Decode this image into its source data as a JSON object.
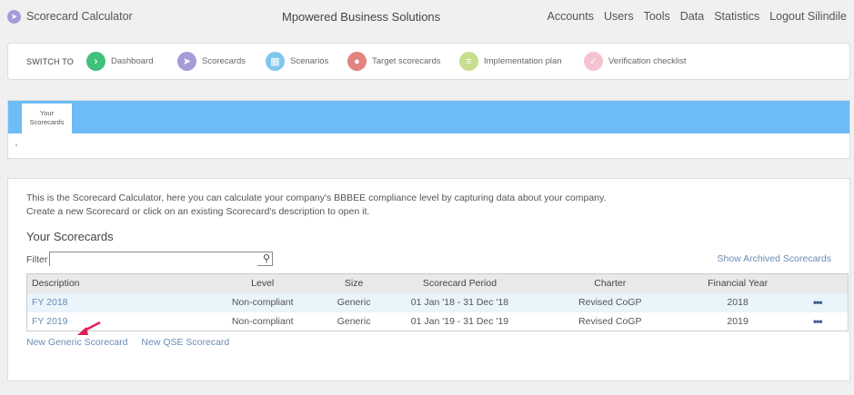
{
  "app": {
    "title": "Scorecard Calculator",
    "company": "Mpowered Business Solutions"
  },
  "topnav": [
    "Accounts",
    "Users",
    "Tools",
    "Data",
    "Statistics",
    "Logout Silindile"
  ],
  "switchbar": {
    "label": "SWITCH TO",
    "items": [
      {
        "label": "Dashboard",
        "icon": "chevron-right-icon",
        "color": "#3fc17a"
      },
      {
        "label": "Scorecards",
        "icon": "paper-plane-icon",
        "color": "#a79ad8"
      },
      {
        "label": "Scenarios",
        "icon": "map-icon",
        "color": "#7fc6ee"
      },
      {
        "label": "Target scorecards",
        "icon": "map-pin-icon",
        "color": "#e2837f"
      },
      {
        "label": "Implementation plan",
        "icon": "list-icon",
        "color": "#c7de8f"
      },
      {
        "label": "Verification checklist",
        "icon": "check-icon",
        "color": "#f5c3d0"
      }
    ]
  },
  "tabs": {
    "active_line1": "Your",
    "active_line2": "Scorecards",
    "accent": "#6dbcf5"
  },
  "main": {
    "intro_line1": "This is the Scorecard Calculator, here you can calculate your company's BBBEE compliance level by capturing data about your company.",
    "intro_line2": "Create a new Scorecard or click on an existing Scorecard's description to open it.",
    "section_title": "Your Scorecards",
    "filter_label": "Filter",
    "filter_value": "",
    "archived_link": "Show Archived Scorecards",
    "columns": [
      "Description",
      "Level",
      "Size",
      "Scorecard Period",
      "Charter",
      "Financial Year"
    ],
    "rows": [
      {
        "description": "FY 2018",
        "level": "Non-compliant",
        "size": "Generic",
        "period": "01 Jan '18 - 31 Dec '18",
        "charter": "Revised CoGP",
        "year": "2018",
        "menu": "•••"
      },
      {
        "description": "FY 2019",
        "level": "Non-compliant",
        "size": "Generic",
        "period": "01 Jan '19 - 31 Dec '19",
        "charter": "Revised CoGP",
        "year": "2019",
        "menu": "•••"
      }
    ],
    "new_generic": "New Generic Scorecard",
    "new_qse": "New QSE Scorecard"
  }
}
